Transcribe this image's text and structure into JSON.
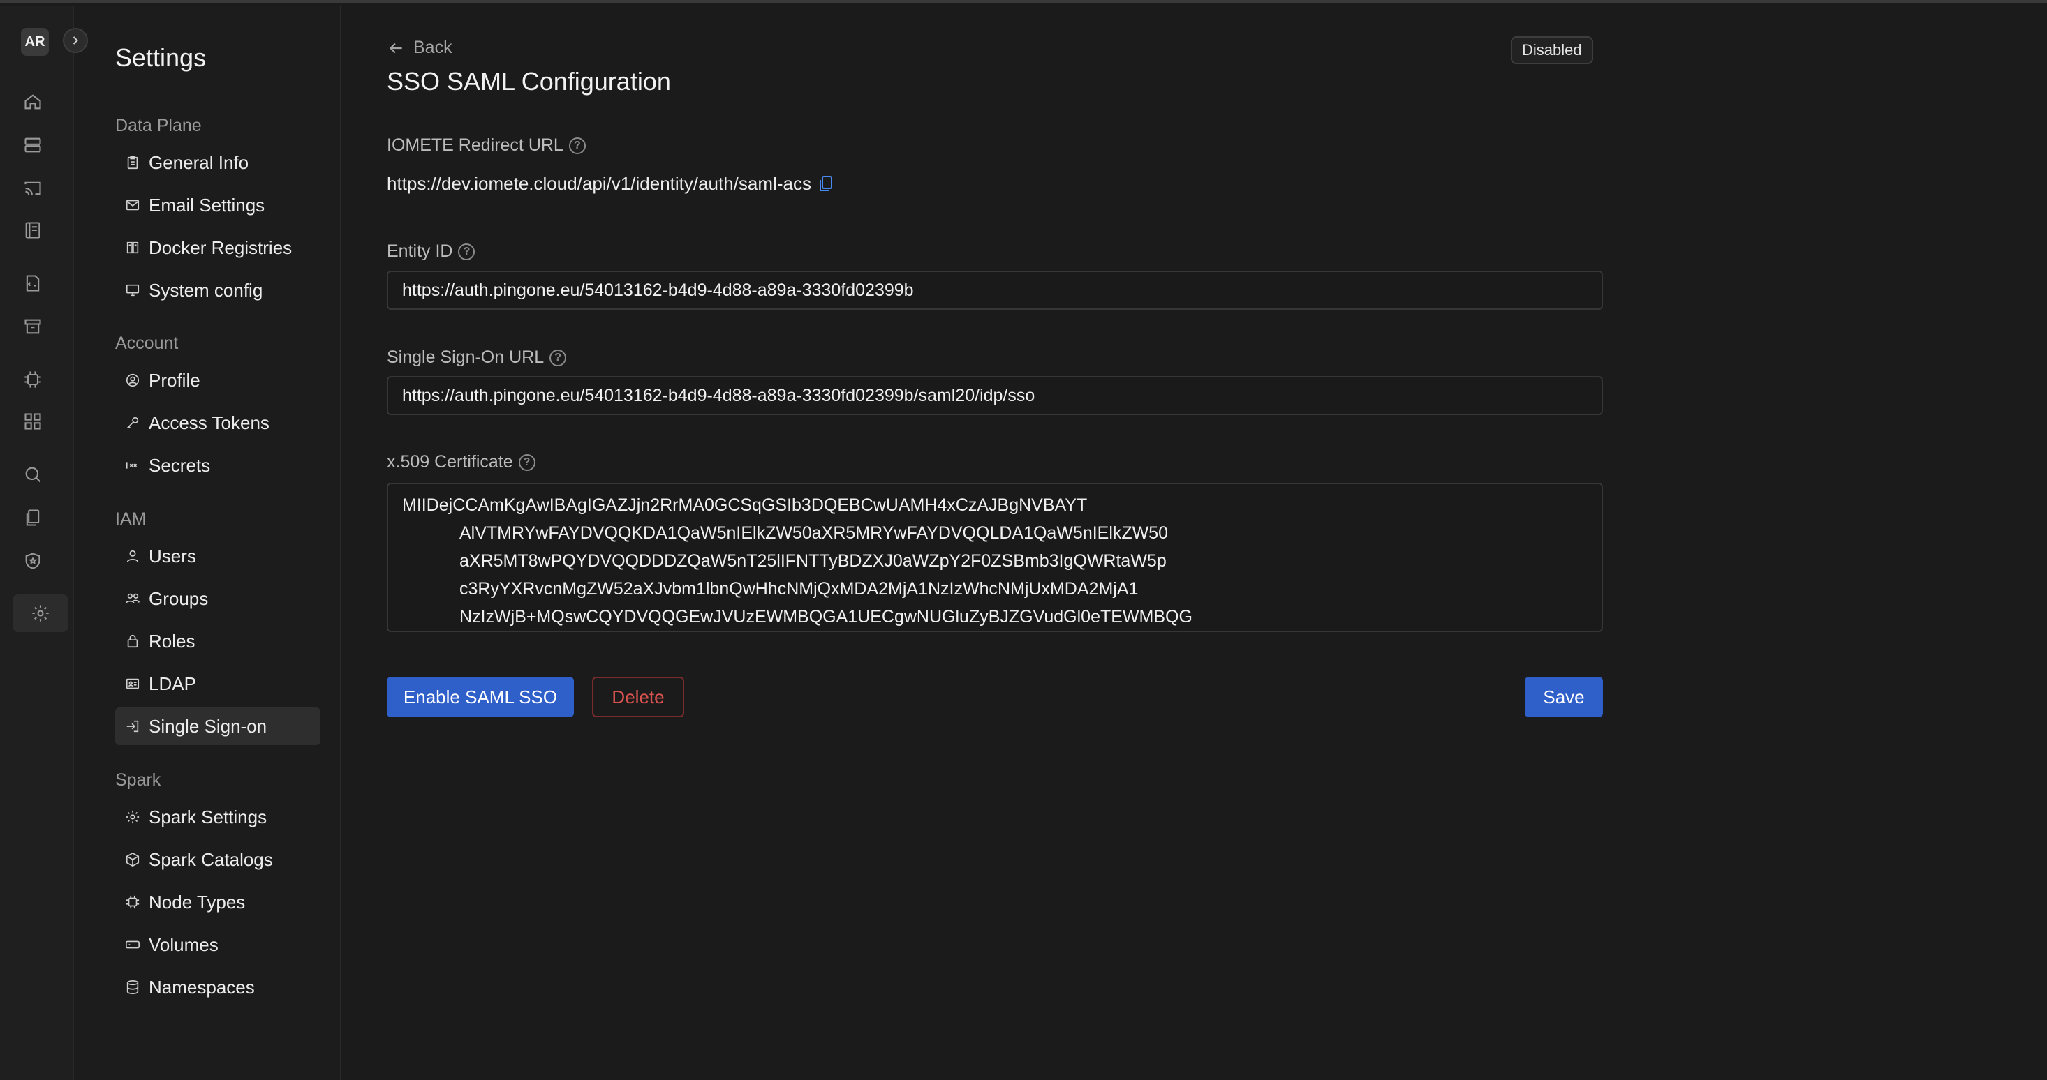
{
  "user": {
    "initials": "AR"
  },
  "settings": {
    "title": "Settings",
    "sections": [
      {
        "heading": "Data Plane",
        "items": [
          "General Info",
          "Email Settings",
          "Docker Registries",
          "System config"
        ]
      },
      {
        "heading": "Account",
        "items": [
          "Profile",
          "Access Tokens",
          "Secrets"
        ]
      },
      {
        "heading": "IAM",
        "items": [
          "Users",
          "Groups",
          "Roles",
          "LDAP",
          "Single Sign-on"
        ]
      },
      {
        "heading": "Spark",
        "items": [
          "Spark Settings",
          "Spark Catalogs",
          "Node Types",
          "Volumes",
          "Namespaces"
        ]
      }
    ],
    "active_item": "Single Sign-on"
  },
  "page": {
    "back_label": "Back",
    "title": "SSO SAML Configuration",
    "status": "Disabled",
    "redirect": {
      "label": "IOMETE Redirect URL",
      "value": "https://dev.iomete.cloud/api/v1/identity/auth/saml-acs"
    },
    "entity_id": {
      "label": "Entity ID",
      "value": "https://auth.pingone.eu/54013162-b4d9-4d88-a89a-3330fd02399b"
    },
    "sso_url": {
      "label": "Single Sign-On URL",
      "value": "https://auth.pingone.eu/54013162-b4d9-4d88-a89a-3330fd02399b/saml20/idp/sso"
    },
    "certificate": {
      "label": "x.509 Certificate",
      "lines": [
        "MIIDejCCAmKgAwIBAgIGAZJjn2RrMA0GCSqGSIb3DQEBCwUAMH4xCzAJBgNVBAYT",
        "AlVTMRYwFAYDVQQKDA1QaW5nIElkZW50aXR5MRYwFAYDVQQLDA1QaW5nIElkZW50",
        "aXR5MT8wPQYDVQQDDDZQaW5nT25lIFNTTyBDZXJ0aWZpY2F0ZSBmb3IgQWRtaW5p",
        "c3RyYXRvcnMgZW52aXJvbm1lbnQwHhcNMjQxMDA2MjA1NzIzWhcNMjUxMDA2MjA1",
        "NzIzWjB+MQswCQYDVQQGEwJVUzEWMBQGA1UECgwNUGluZyBJZGVudGl0eTEWMBQG"
      ]
    },
    "buttons": {
      "enable": "Enable SAML SSO",
      "delete": "Delete",
      "save": "Save"
    }
  },
  "colors": {
    "accent": "#2f5fc9",
    "danger": "#d9534f",
    "copy": "#4a8af0"
  }
}
